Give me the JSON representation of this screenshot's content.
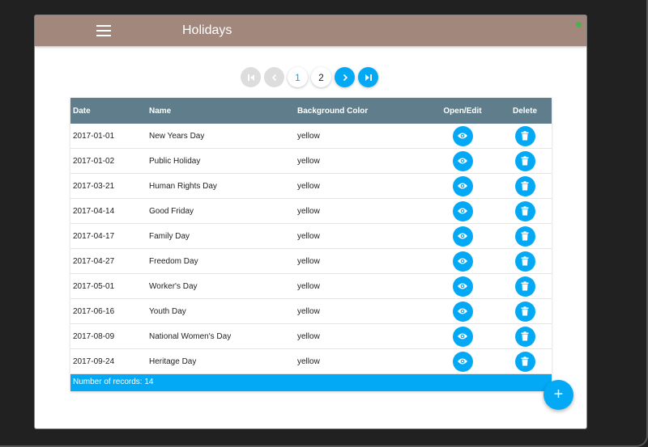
{
  "header": {
    "title": "Holidays"
  },
  "pager": {
    "pages": [
      "1",
      "2"
    ],
    "current": "1"
  },
  "table": {
    "columns": [
      "Date",
      "Name",
      "Background Color",
      "Open/Edit",
      "Delete"
    ],
    "rows": [
      [
        "2017-01-01",
        "New Years Day",
        "yellow"
      ],
      [
        "2017-01-02",
        "Public Holiday",
        "yellow"
      ],
      [
        "2017-03-21",
        "Human Rights Day",
        "yellow"
      ],
      [
        "2017-04-14",
        "Good Friday",
        "yellow"
      ],
      [
        "2017-04-17",
        "Family Day",
        "yellow"
      ],
      [
        "2017-04-27",
        "Freedom Day",
        "yellow"
      ],
      [
        "2017-05-01",
        "Worker's Day",
        "yellow"
      ],
      [
        "2017-06-16",
        "Youth Day",
        "yellow"
      ],
      [
        "2017-08-09",
        "National Women's Day",
        "yellow"
      ],
      [
        "2017-09-24",
        "Heritage Day",
        "yellow"
      ]
    ],
    "footer": "Number of records: 14"
  },
  "fab": {
    "label": "+"
  },
  "colors": {
    "header": "#a1877c",
    "accent": "#03a9f4",
    "table_head": "#607d8b"
  }
}
